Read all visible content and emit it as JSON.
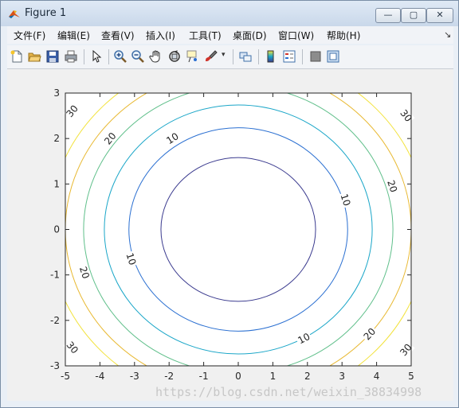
{
  "window": {
    "title": "Figure 1",
    "min_glyph": "—",
    "max_glyph": "▢",
    "close_glyph": "✕"
  },
  "menu": {
    "items": [
      {
        "label": "文件(F)",
        "name": "menu-file"
      },
      {
        "label": "编辑(E)",
        "name": "menu-edit"
      },
      {
        "label": "查看(V)",
        "name": "menu-view"
      },
      {
        "label": "插入(I)",
        "name": "menu-insert"
      },
      {
        "label": "工具(T)",
        "name": "menu-tools"
      },
      {
        "label": "桌面(D)",
        "name": "menu-desktop"
      },
      {
        "label": "窗口(W)",
        "name": "menu-window"
      },
      {
        "label": "帮助(H)",
        "name": "menu-help"
      }
    ],
    "overflow_glyph": "↘"
  },
  "toolbar": {
    "icons": [
      "new-figure-icon",
      "open-file-icon",
      "save-icon",
      "print-icon",
      "edit-plot-arrow-icon",
      "zoom-in-icon",
      "zoom-out-icon",
      "pan-hand-icon",
      "rotate-3d-icon",
      "data-cursor-icon",
      "brush-icon",
      "link-plot-icon",
      "colorbar-icon",
      "legend-icon",
      "hide-plot-tools-icon",
      "show-plot-tools-icon"
    ]
  },
  "chart_data": {
    "type": "contour",
    "title": "",
    "xlabel": "",
    "ylabel": "",
    "xlim": [
      -5,
      5
    ],
    "ylim": [
      -3,
      3
    ],
    "xticks": [
      -5,
      -4,
      -3,
      -2,
      -1,
      0,
      1,
      2,
      3,
      4,
      5
    ],
    "yticks": [
      -3,
      -2,
      -1,
      0,
      1,
      2,
      3
    ],
    "grid": false,
    "contour_function": "z = x^2 + 2*y^2 (estimated)",
    "levels": [
      5,
      10,
      15,
      20,
      25,
      30
    ],
    "level_colors": [
      "#3b3b8f",
      "#2a6fd1",
      "#1aa6c8",
      "#5fbf8a",
      "#e8b830",
      "#f2e23a"
    ],
    "labeled_levels": [
      {
        "text": "30",
        "x": -4.8,
        "y": 2.6
      },
      {
        "text": "20",
        "x": -3.7,
        "y": 2.0
      },
      {
        "text": "10",
        "x": -1.9,
        "y": 2.0
      },
      {
        "text": "30",
        "x": 4.85,
        "y": 2.5
      },
      {
        "text": "20",
        "x": 4.45,
        "y": 0.95
      },
      {
        "text": "10",
        "x": 3.1,
        "y": 0.65
      },
      {
        "text": "10",
        "x": -3.1,
        "y": -0.65
      },
      {
        "text": "20",
        "x": -4.45,
        "y": -0.95
      },
      {
        "text": "10",
        "x": 1.9,
        "y": -2.4
      },
      {
        "text": "20",
        "x": 3.8,
        "y": -2.3
      },
      {
        "text": "30",
        "x": -4.8,
        "y": -2.6
      },
      {
        "text": "30",
        "x": 4.85,
        "y": -2.65
      }
    ]
  },
  "watermark": "https://blog.csdn.net/weixin_38834998"
}
